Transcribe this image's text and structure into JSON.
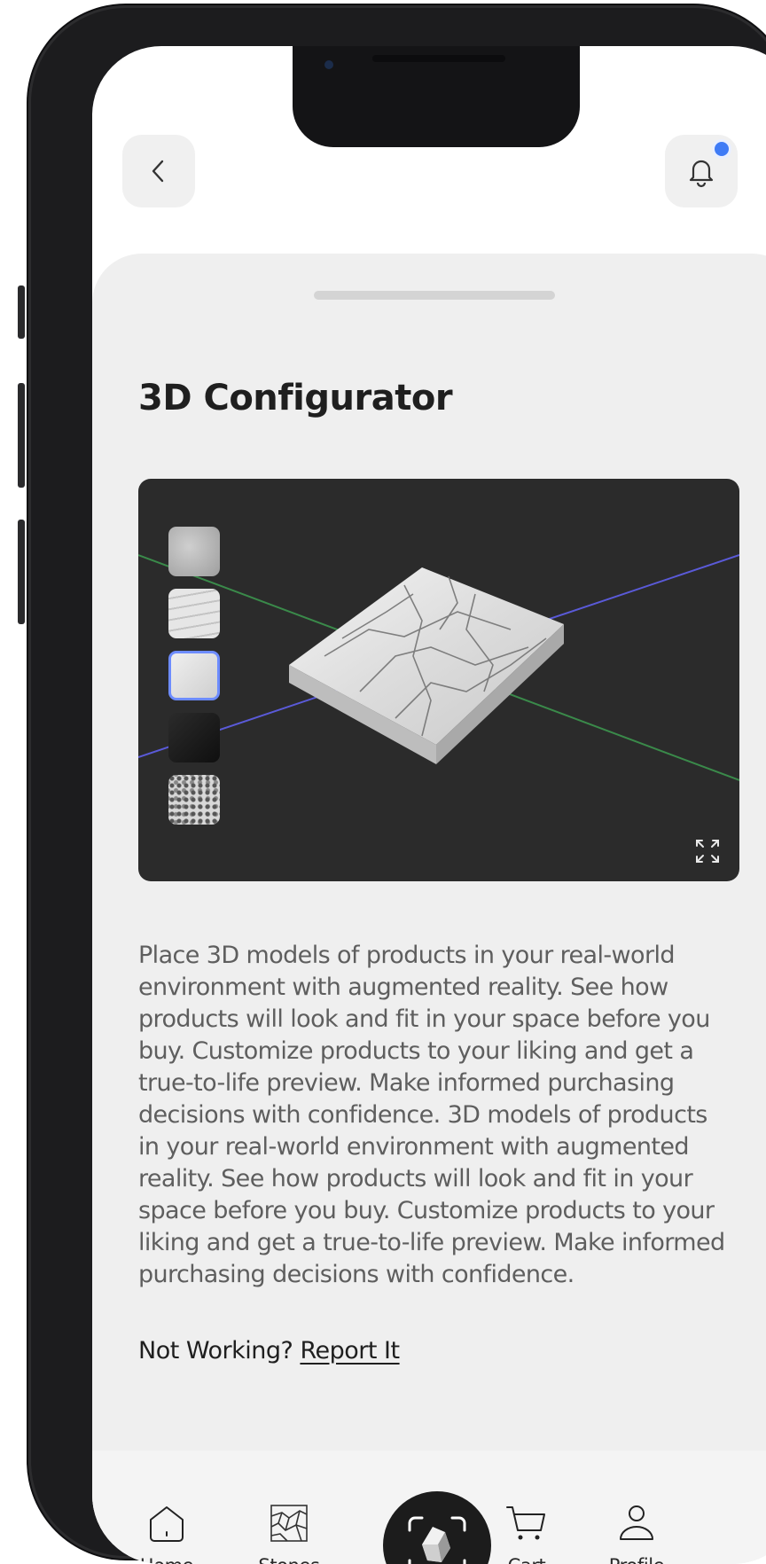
{
  "header": {
    "back_icon": "chevron-left-icon",
    "bell_icon": "bell-icon",
    "has_notification": true,
    "accent_color": "#3f7bf5"
  },
  "page": {
    "title": "3D Configurator"
  },
  "viewer": {
    "model": "marble slab",
    "swatches": [
      {
        "name": "grey-granite",
        "selected": false
      },
      {
        "name": "light-grey-marble",
        "selected": false
      },
      {
        "name": "white-marble",
        "selected": true
      },
      {
        "name": "black-marble",
        "selected": false
      },
      {
        "name": "terrazzo",
        "selected": false
      }
    ],
    "fullscreen_icon": "expand-icon",
    "selection_color": "#6d8cff"
  },
  "description": "Place 3D models of products in your real-world environment with augmented reality. See how products will look and fit in your space before you buy. Customize products to your liking and get a true-to-life preview. Make informed purchasing decisions with confidence. 3D models of products in your real-world environment with augmented reality. See how products will look and fit in your space before you buy. Customize products to your liking and get a true-to-life preview. Make informed purchasing decisions with confidence.",
  "report": {
    "prefix": "Not Working?",
    "link": "Report It"
  },
  "tab_bar": {
    "home": {
      "label": "Home",
      "icon": "home-icon"
    },
    "stones": {
      "label": "Stones",
      "icon": "stones-pattern-icon"
    },
    "scan": {
      "icon": "stone-scan-icon"
    },
    "cart": {
      "label": "Cart",
      "icon": "cart-icon"
    },
    "profile": {
      "label": "Profile",
      "icon": "user-icon"
    }
  }
}
